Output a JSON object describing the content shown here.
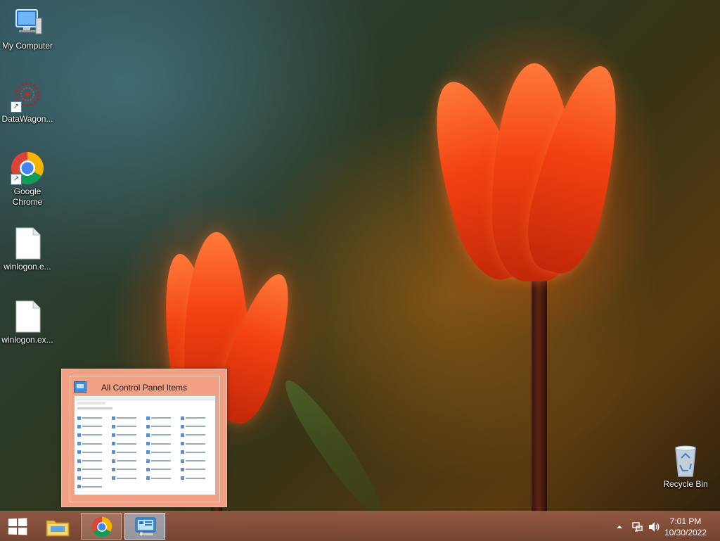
{
  "desktop": {
    "icons": [
      {
        "label": "My Computer",
        "icon": "computer-icon"
      },
      {
        "label": "DataWagon...",
        "icon": "datawagon-icon"
      },
      {
        "label": "Google Chrome",
        "icon": "chrome-icon"
      },
      {
        "label": "winlogon.e...",
        "icon": "file-icon"
      },
      {
        "label": "winlogon.ex...",
        "icon": "file-icon"
      },
      {
        "label": "Recycle Bin",
        "icon": "recycle-bin-icon"
      }
    ]
  },
  "thumbnail_preview": {
    "title": "All Control Panel Items",
    "icon": "control-panel-icon"
  },
  "taskbar": {
    "start_icon": "windows-logo-icon",
    "buttons": [
      {
        "name": "file-explorer",
        "icon": "folder-icon"
      },
      {
        "name": "google-chrome",
        "icon": "chrome-icon"
      },
      {
        "name": "control-panel",
        "icon": "control-panel-icon"
      }
    ],
    "tray": {
      "show_hidden_icon": "chevron-up-icon",
      "network_icon": "network-icon",
      "volume_icon": "speaker-icon"
    },
    "clock": {
      "time": "7:01 PM",
      "date": "10/30/2022"
    }
  },
  "colors": {
    "taskbar": "#8a5844",
    "preview_bg": "#f1a084",
    "chrome_red": "#db4437",
    "chrome_green": "#0f9d58",
    "chrome_yellow": "#f4b400",
    "chrome_blue": "#4285f4"
  }
}
